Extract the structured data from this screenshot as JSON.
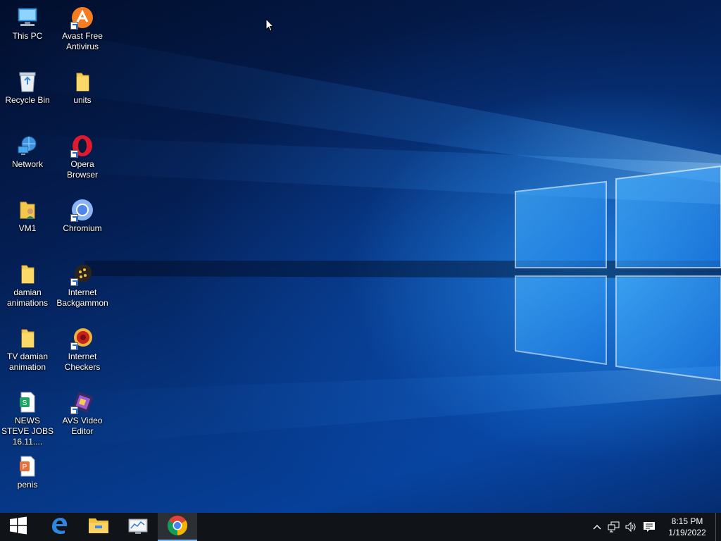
{
  "desktop": {
    "icons": [
      {
        "id": "this-pc",
        "label": "This PC",
        "icon": "computer-icon",
        "shortcut": false
      },
      {
        "id": "avast",
        "label": "Avast Free Antivirus",
        "icon": "avast-icon",
        "shortcut": true
      },
      {
        "id": "recycle-bin",
        "label": "Recycle Bin",
        "icon": "recycle-bin-icon",
        "shortcut": false
      },
      {
        "id": "units",
        "label": "units",
        "icon": "folder-icon",
        "shortcut": false
      },
      {
        "id": "network",
        "label": "Network",
        "icon": "network-icon",
        "shortcut": false
      },
      {
        "id": "opera",
        "label": "Opera Browser",
        "icon": "opera-icon",
        "shortcut": true
      },
      {
        "id": "vm1",
        "label": "VM1",
        "icon": "user-folder-icon",
        "shortcut": false
      },
      {
        "id": "chromium",
        "label": "Chromium",
        "icon": "chromium-icon",
        "shortcut": true
      },
      {
        "id": "damian-animations",
        "label": "damian animations",
        "icon": "folder-icon",
        "shortcut": false
      },
      {
        "id": "internet-backgammon",
        "label": "Internet Backgammon",
        "icon": "backgammon-icon",
        "shortcut": true
      },
      {
        "id": "tv-damian-animation",
        "label": "TV  damian animation",
        "icon": "folder-icon",
        "shortcut": false
      },
      {
        "id": "internet-checkers",
        "label": "Internet Checkers",
        "icon": "checkers-icon",
        "shortcut": true
      },
      {
        "id": "news-steve-jobs",
        "label": "NEWS STEVE JOBS 16.11....",
        "icon": "spreadsheet-file-icon",
        "shortcut": false
      },
      {
        "id": "avs-video-editor",
        "label": "AVS Video Editor",
        "icon": "video-editor-icon",
        "shortcut": true
      },
      {
        "id": "penis",
        "label": "penis",
        "icon": "presentation-file-icon",
        "shortcut": false
      }
    ]
  },
  "taskbar": {
    "start_icon": "windows-logo-icon",
    "pinned": [
      {
        "id": "edge",
        "icon": "edge-icon",
        "active": false
      },
      {
        "id": "file-explorer",
        "icon": "file-explorer-icon",
        "active": false
      },
      {
        "id": "control-panel",
        "icon": "system-monitor-icon",
        "active": false
      },
      {
        "id": "chrome",
        "icon": "chrome-icon",
        "active": true
      }
    ],
    "tray": {
      "icons": [
        "chevron-up-icon",
        "network-wired-icon",
        "speaker-icon",
        "notification-icon"
      ],
      "time": "8:15 PM",
      "date": "1/19/2022"
    }
  },
  "colors": {
    "taskbar_bg": "#101317",
    "active_indicator": "#77b7f5",
    "wallpaper_blue": "#06409a"
  }
}
